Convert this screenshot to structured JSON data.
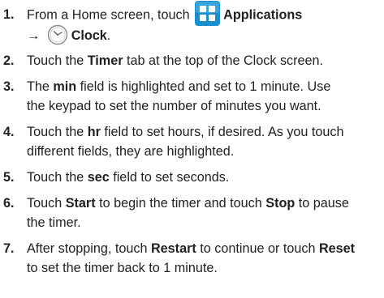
{
  "steps": [
    {
      "number": "1.",
      "line1_prefix": "From a Home screen, touch",
      "apps_icon": "applications-grid-icon",
      "apps_label": "Applications",
      "arrow": "→",
      "clock_icon": "clock-icon",
      "clock_label": "Clock",
      "clock_suffix": "."
    },
    {
      "number": "2.",
      "t1": "Touch the ",
      "b1": "Timer",
      "t2": " tab at the top of the Clock screen."
    },
    {
      "number": "3.",
      "t1": "The ",
      "b1": "min",
      "t2": " field is highlighted and set to 1 minute. Use",
      "line2": "the keypad to set the number of minutes you want."
    },
    {
      "number": "4.",
      "t1": "Touch the ",
      "b1": "hr",
      "t2": " field to set hours, if desired. As you touch",
      "line2": "different fields, they are highlighted."
    },
    {
      "number": "5.",
      "t1": "Touch the ",
      "b1": "sec",
      "t2": " field to set seconds."
    },
    {
      "number": "6.",
      "t1": "Touch ",
      "b1": "Start",
      "t2": " to begin the timer and touch ",
      "b2": "Stop",
      "t3": " to pause",
      "line2": "the timer."
    },
    {
      "number": "7.",
      "t1": "After stopping, touch ",
      "b1": "Restart",
      "t2": " to continue or touch ",
      "b2": "Reset",
      "line2": "to set the timer back to 1 minute."
    }
  ],
  "colors": {
    "text": "#231f20",
    "apps_icon_blue": "#1a8fd0",
    "apps_icon_light": "#6fc3ee"
  }
}
